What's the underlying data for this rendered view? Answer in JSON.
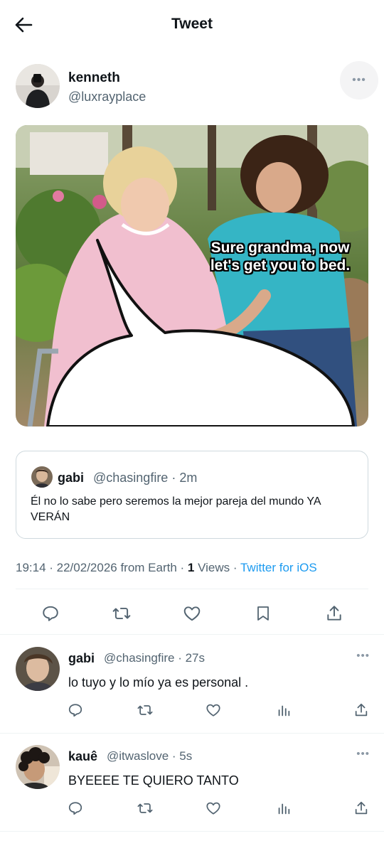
{
  "header": {
    "title": "Tweet"
  },
  "tweet": {
    "author_name": "kenneth",
    "author_handle": "@luxrayplace",
    "media_caption_line1": "Sure grandma, now",
    "media_caption_line2": "let's get you to bed.",
    "quote": {
      "name": "gabi",
      "handle_time": "@chasingfire · 2m",
      "text": "Él no lo sabe pero seremos la mejor pareja del mundo YA VERÁN"
    },
    "meta": {
      "time_date": "19:14 · 22/02/2026 from Earth · ",
      "views_count": "1",
      "views_label": " Views · ",
      "source": "Twitter for iOS"
    }
  },
  "replies": [
    {
      "name": "gabi",
      "handle_time": "@chasingfire · 27s",
      "text": "lo tuyo y lo mío ya es personal ."
    },
    {
      "name": "kauê",
      "handle_time": "@itwaslove · 5s",
      "text": "BYEEEE TE QUIERO TANTO"
    }
  ],
  "icons": {
    "back": "arrow-left-icon",
    "more": "more-dots-icon",
    "reply": "reply-icon",
    "retweet": "retweet-icon",
    "like": "heart-icon",
    "bookmark": "bookmark-icon",
    "share": "share-icon",
    "views": "views-icon"
  },
  "colors": {
    "link": "#1d9bf0",
    "secondary": "#536471",
    "border": "#cfd9de"
  }
}
